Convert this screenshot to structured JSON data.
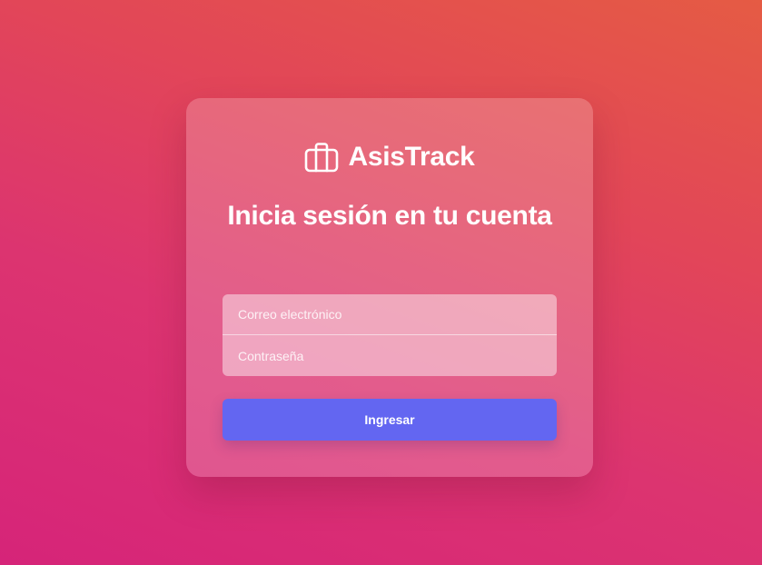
{
  "app": {
    "name": "AsisTrack",
    "logo_icon": "briefcase-icon"
  },
  "login": {
    "heading": "Inicia sesión en tu cuenta",
    "email_placeholder": "Correo electrónico",
    "password_placeholder": "Contraseña",
    "submit_label": "Ingresar"
  },
  "colors": {
    "background_start": "#d62479",
    "background_end": "#e55b44",
    "button": "#6366f1",
    "text": "#ffffff"
  }
}
